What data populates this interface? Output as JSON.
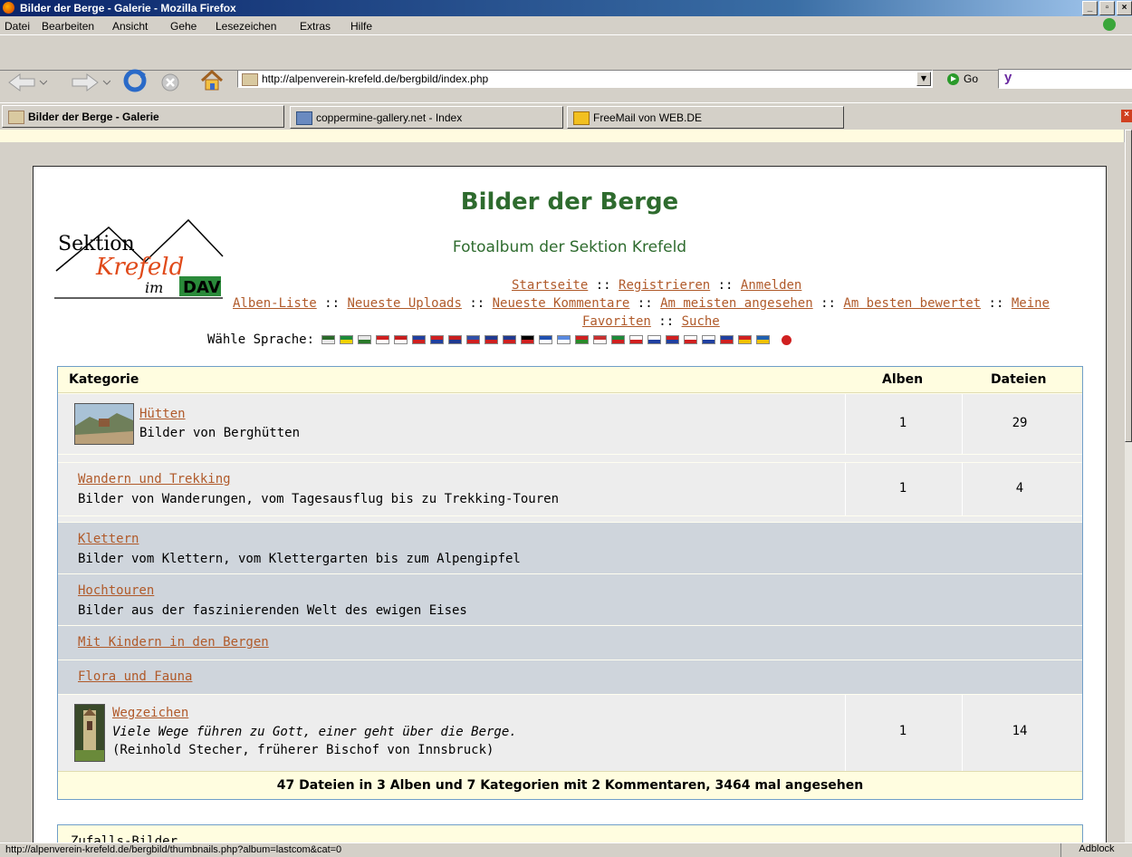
{
  "window": {
    "title": "Bilder der Berge - Galerie - Mozilla Firefox",
    "controls": [
      "_",
      "▫",
      "×"
    ]
  },
  "menu": {
    "items": [
      "Datei",
      "Bearbeiten",
      "Ansicht",
      "Gehe",
      "Lesezeichen",
      "Extras",
      "Hilfe"
    ]
  },
  "toolbar": {
    "url": "http://alpenverein-krefeld.de/bergbild/index.php",
    "go_label": "Go",
    "search_logo": "y"
  },
  "tabs": [
    {
      "label": "Bilder der Berge - Galerie",
      "active": true
    },
    {
      "label": "coppermine-gallery.net - Index",
      "active": false
    },
    {
      "label": "FreeMail von WEB.DE",
      "active": false
    }
  ],
  "site": {
    "title": "Bilder der Berge",
    "subtitle": "Fotoalbum der Sektion Krefeld",
    "logo_text_1": "Sektion",
    "logo_text_2": "Krefeld",
    "logo_text_3": "im",
    "logo_text_4": "DAV",
    "nav1": [
      "Startseite",
      "Registrieren",
      "Anmelden"
    ],
    "nav2": [
      "Alben-Liste",
      "Neueste Uploads",
      "Neueste Kommentare",
      "Am meisten angesehen",
      "Am besten bewertet",
      "Meine"
    ],
    "nav3": [
      "Favoriten",
      "Suche"
    ],
    "separator": "::",
    "language_label": "Wähle Sprache:"
  },
  "flag_colors": [
    [
      "#2a6a2a",
      "#e8e8e8"
    ],
    [
      "#1d8a3a",
      "#f2d200"
    ],
    [
      "#e8e8e8",
      "#2a7a2a"
    ],
    [
      "#d02020",
      "#ffffff"
    ],
    [
      "#c81e1e",
      "#ffffff"
    ],
    [
      "#2040a0",
      "#d02020"
    ],
    [
      "#d02020",
      "#2040a0"
    ],
    [
      "#c81e1e",
      "#203a90"
    ],
    [
      "#3050a8",
      "#d02020"
    ],
    [
      "#203a90",
      "#d02020"
    ],
    [
      "#203a90",
      "#d02020"
    ],
    [
      "#000000",
      "#d02020"
    ],
    [
      "#2050b0",
      "#ffffff"
    ],
    [
      "#5a8ae0",
      "#ffffff"
    ],
    [
      "#d02020",
      "#2a8a2a"
    ],
    [
      "#c83030",
      "#ffffff"
    ],
    [
      "#1d8a3a",
      "#d02020"
    ],
    [
      "#ffffff",
      "#d02020"
    ],
    [
      "#ffffff",
      "#2040a0"
    ],
    [
      "#d02020",
      "#2040a0"
    ],
    [
      "#ffffff",
      "#d02020"
    ],
    [
      "#ffffff",
      "#2040a0"
    ],
    [
      "#2040a0",
      "#d02020"
    ],
    [
      "#d02020",
      "#f2c200"
    ],
    [
      "#2060b0",
      "#f2c200"
    ]
  ],
  "categories": {
    "headers": {
      "name": "Kategorie",
      "albums": "Alben",
      "files": "Dateien"
    },
    "rows": [
      {
        "name": "Hütten",
        "desc": "Bilder von Berghütten",
        "albums": "1",
        "files": "29",
        "thumb": true,
        "type": "sub"
      },
      {
        "name": "Wandern und Trekking",
        "desc": "Bilder von Wanderungen, vom Tagesausflug bis zu Trekking-Touren",
        "albums": "1",
        "files": "4",
        "thumb": false,
        "type": "sub"
      },
      {
        "name": "Klettern",
        "desc": "Bilder vom Klettern, vom Klettergarten bis zum Alpengipfel",
        "type": "top"
      },
      {
        "name": "Hochtouren",
        "desc": "Bilder aus der faszinierenden Welt des ewigen Eises",
        "type": "top"
      },
      {
        "name": "Mit Kindern in den Bergen",
        "type": "top"
      },
      {
        "name": "Flora und Fauna",
        "type": "top"
      },
      {
        "name": "Wegzeichen",
        "desc": "Viele Wege führen zu Gott, einer geht über die Berge.",
        "desc2": "(Reinhold Stecher, früherer Bischof von Innsbruck)",
        "albums": "1",
        "files": "14",
        "thumb": true,
        "type": "sub"
      }
    ],
    "footer": "47 Dateien in 3 Alben und 7 Kategorien mit 2 Kommentaren, 3464 mal angesehen"
  },
  "random": {
    "label": "Zufalls-Bilder"
  },
  "status": {
    "text": "http://alpenverein-krefeld.de/bergbild/thumbnails.php?album=lastcom&cat=0",
    "addon": "Adblock"
  }
}
